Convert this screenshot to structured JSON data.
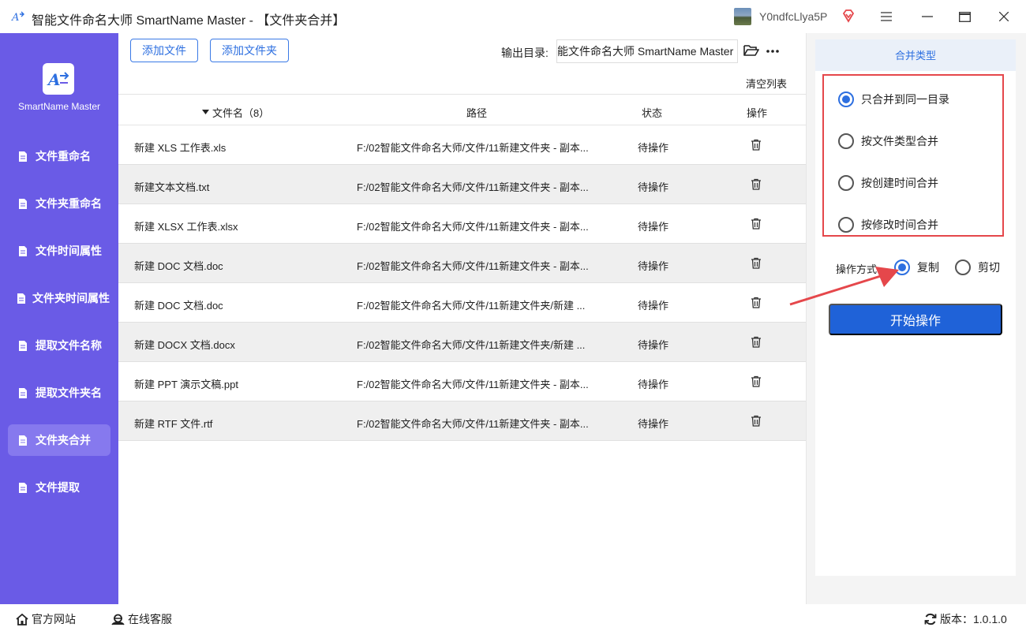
{
  "window": {
    "title": "智能文件命名大师 SmartName Master - 【文件夹合并】",
    "username": "Y0ndfcLlya5P",
    "icons": [
      "app-logo-icon",
      "vip-diamond-icon",
      "menu-icon",
      "maximize-icon",
      "close-icon"
    ]
  },
  "sidebar": {
    "brand": "SmartName Master",
    "items": [
      {
        "label": "文件重命名"
      },
      {
        "label": "文件夹重命名"
      },
      {
        "label": "文件时间属性"
      },
      {
        "label": "文件夹时间属性"
      },
      {
        "label": "提取文件名称"
      },
      {
        "label": "提取文件夹名"
      },
      {
        "label": "文件夹合并"
      },
      {
        "label": "文件提取"
      }
    ],
    "active_index": 6
  },
  "toolbar": {
    "add_file": "添加文件",
    "add_folder": "添加文件夹",
    "output_label": "输出目录:",
    "output_path": "能文件命名大师 SmartName Master",
    "clear_list": "清空列表"
  },
  "table": {
    "headers": {
      "name": "文件名（8）",
      "path": "路径",
      "status": "状态",
      "action": "操作"
    },
    "rows": [
      {
        "name": "新建 XLS 工作表.xls",
        "path": "F:/02智能文件命名大师/文件/11新建文件夹 - 副本...",
        "status": "待操作"
      },
      {
        "name": "新建文本文档.txt",
        "path": "F:/02智能文件命名大师/文件/11新建文件夹 - 副本...",
        "status": "待操作"
      },
      {
        "name": "新建 XLSX 工作表.xlsx",
        "path": "F:/02智能文件命名大师/文件/11新建文件夹 - 副本...",
        "status": "待操作"
      },
      {
        "name": "新建 DOC 文档.doc",
        "path": "F:/02智能文件命名大师/文件/11新建文件夹 - 副本...",
        "status": "待操作"
      },
      {
        "name": "新建 DOC 文档.doc",
        "path": "F:/02智能文件命名大师/文件/11新建文件夹/新建 ...",
        "status": "待操作"
      },
      {
        "name": "新建 DOCX 文档.docx",
        "path": "F:/02智能文件命名大师/文件/11新建文件夹/新建 ...",
        "status": "待操作"
      },
      {
        "name": "新建 PPT 演示文稿.ppt",
        "path": "F:/02智能文件命名大师/文件/11新建文件夹 - 副本...",
        "status": "待操作"
      },
      {
        "name": "新建 RTF 文件.rtf",
        "path": "F:/02智能文件命名大师/文件/11新建文件夹 - 副本...",
        "status": "待操作"
      }
    ]
  },
  "panel": {
    "header": "合并类型",
    "merge_options": [
      {
        "label": "只合并到同一目录",
        "selected": true
      },
      {
        "label": "按文件类型合并",
        "selected": false
      },
      {
        "label": "按创建时间合并",
        "selected": false
      },
      {
        "label": "按修改时间合并",
        "selected": false
      }
    ],
    "operation_label": "操作方式",
    "operation_options": [
      {
        "label": "复制",
        "selected": true
      },
      {
        "label": "剪切",
        "selected": false
      }
    ],
    "start_button": "开始操作"
  },
  "footer": {
    "website": "官方网站",
    "support": "在线客服",
    "version": "版本：1.0.1.0"
  },
  "colors": {
    "sidebar": "#6a5be6",
    "sidebar_active": "#8679ee",
    "accent": "#2d6fe0",
    "primary_button": "#1f62d8",
    "highlight": "#e5474b"
  }
}
